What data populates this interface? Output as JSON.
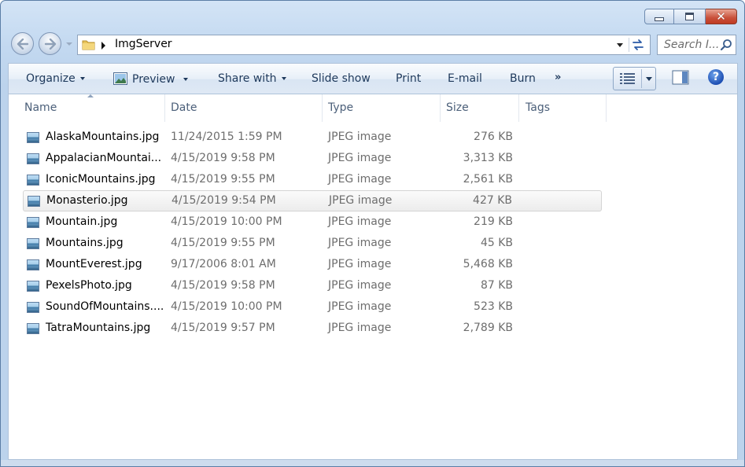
{
  "window": {
    "caption_buttons": [
      "minimize",
      "maximize",
      "close"
    ]
  },
  "address": {
    "crumbs": [
      "ImgServer"
    ]
  },
  "search": {
    "placeholder": "Search I..."
  },
  "toolbar": {
    "organize": "Organize",
    "preview": "Preview",
    "share_with": "Share with",
    "slide_show": "Slide show",
    "print": "Print",
    "email": "E-mail",
    "burn": "Burn",
    "more": "»"
  },
  "columns": {
    "name": "Name",
    "date": "Date",
    "type": "Type",
    "size": "Size",
    "tags": "Tags"
  },
  "files": [
    {
      "name": "AlaskaMountains.jpg",
      "date": "11/24/2015 1:59 PM",
      "type": "JPEG image",
      "size": "276 KB"
    },
    {
      "name": "AppalacianMountai...",
      "date": "4/15/2019 9:58 PM",
      "type": "JPEG image",
      "size": "3,313 KB"
    },
    {
      "name": "IconicMountains.jpg",
      "date": "4/15/2019 9:55 PM",
      "type": "JPEG image",
      "size": "2,561 KB"
    },
    {
      "name": "Monasterio.jpg",
      "date": "4/15/2019 9:54 PM",
      "type": "JPEG image",
      "size": "427 KB"
    },
    {
      "name": "Mountain.jpg",
      "date": "4/15/2019 10:00 PM",
      "type": "JPEG image",
      "size": "219 KB"
    },
    {
      "name": "Mountains.jpg",
      "date": "4/15/2019 9:55 PM",
      "type": "JPEG image",
      "size": "45 KB"
    },
    {
      "name": "MountEverest.jpg",
      "date": "9/17/2006 8:01 AM",
      "type": "JPEG image",
      "size": "5,468 KB"
    },
    {
      "name": "PexelsPhoto.jpg",
      "date": "4/15/2019 9:58 PM",
      "type": "JPEG image",
      "size": "87 KB"
    },
    {
      "name": "SoundOfMountains....",
      "date": "4/15/2019 10:00 PM",
      "type": "JPEG image",
      "size": "523 KB"
    },
    {
      "name": "TatraMountains.jpg",
      "date": "4/15/2019 9:57 PM",
      "type": "JPEG image",
      "size": "2,789 KB"
    }
  ],
  "hovered_row": 3,
  "colors": {
    "accent": "#1e395b",
    "header_text": "#4c607a",
    "secondary_text": "#6d6d6d"
  }
}
